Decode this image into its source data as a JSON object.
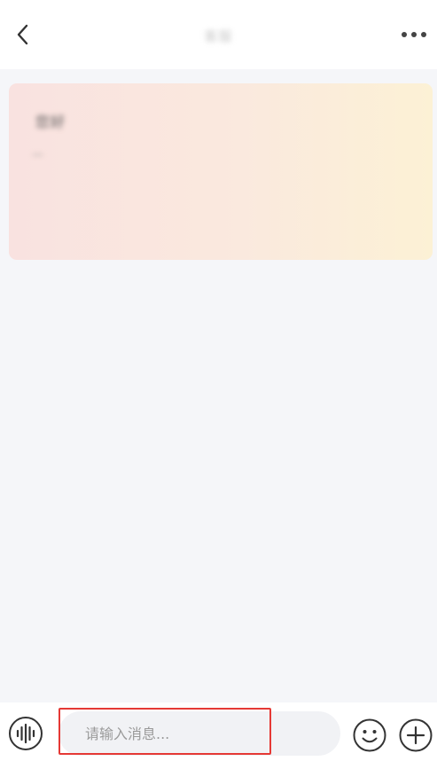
{
  "header": {
    "title": "客服",
    "back_icon": "chevron-left-icon",
    "more_icon": "more-horizontal-icon"
  },
  "card": {
    "line1": "您好",
    "line2": "—"
  },
  "input_bar": {
    "placeholder": "请输入消息...",
    "value": "",
    "voice_icon": "voice-wave-icon",
    "emoji_icon": "smiley-icon",
    "add_icon": "plus-circle-icon",
    "highlight_color": "#e53935"
  }
}
